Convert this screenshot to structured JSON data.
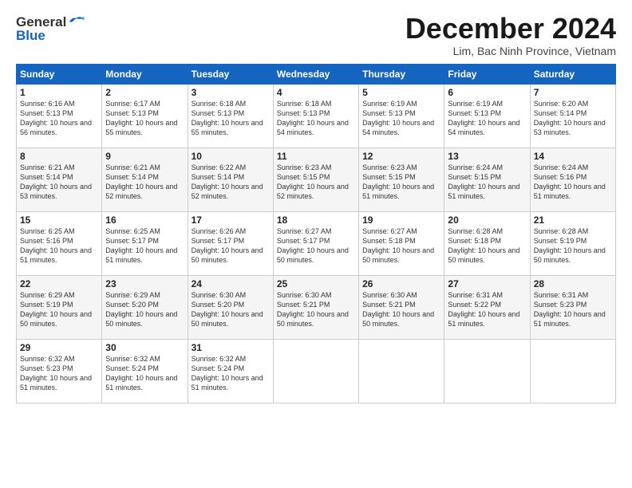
{
  "logo": {
    "general": "General",
    "blue": "Blue"
  },
  "title": "December 2024",
  "location": "Lim, Bac Ninh Province, Vietnam",
  "weekdays": [
    "Sunday",
    "Monday",
    "Tuesday",
    "Wednesday",
    "Thursday",
    "Friday",
    "Saturday"
  ],
  "weeks": [
    [
      {
        "day": "1",
        "sunrise": "6:16 AM",
        "sunset": "5:13 PM",
        "daylight": "10 hours and 56 minutes."
      },
      {
        "day": "2",
        "sunrise": "6:17 AM",
        "sunset": "5:13 PM",
        "daylight": "10 hours and 55 minutes."
      },
      {
        "day": "3",
        "sunrise": "6:18 AM",
        "sunset": "5:13 PM",
        "daylight": "10 hours and 55 minutes."
      },
      {
        "day": "4",
        "sunrise": "6:18 AM",
        "sunset": "5:13 PM",
        "daylight": "10 hours and 54 minutes."
      },
      {
        "day": "5",
        "sunrise": "6:19 AM",
        "sunset": "5:13 PM",
        "daylight": "10 hours and 54 minutes."
      },
      {
        "day": "6",
        "sunrise": "6:19 AM",
        "sunset": "5:13 PM",
        "daylight": "10 hours and 54 minutes."
      },
      {
        "day": "7",
        "sunrise": "6:20 AM",
        "sunset": "5:14 PM",
        "daylight": "10 hours and 53 minutes."
      }
    ],
    [
      {
        "day": "8",
        "sunrise": "6:21 AM",
        "sunset": "5:14 PM",
        "daylight": "10 hours and 53 minutes."
      },
      {
        "day": "9",
        "sunrise": "6:21 AM",
        "sunset": "5:14 PM",
        "daylight": "10 hours and 52 minutes."
      },
      {
        "day": "10",
        "sunrise": "6:22 AM",
        "sunset": "5:14 PM",
        "daylight": "10 hours and 52 minutes."
      },
      {
        "day": "11",
        "sunrise": "6:23 AM",
        "sunset": "5:15 PM",
        "daylight": "10 hours and 52 minutes."
      },
      {
        "day": "12",
        "sunrise": "6:23 AM",
        "sunset": "5:15 PM",
        "daylight": "10 hours and 51 minutes."
      },
      {
        "day": "13",
        "sunrise": "6:24 AM",
        "sunset": "5:15 PM",
        "daylight": "10 hours and 51 minutes."
      },
      {
        "day": "14",
        "sunrise": "6:24 AM",
        "sunset": "5:16 PM",
        "daylight": "10 hours and 51 minutes."
      }
    ],
    [
      {
        "day": "15",
        "sunrise": "6:25 AM",
        "sunset": "5:16 PM",
        "daylight": "10 hours and 51 minutes."
      },
      {
        "day": "16",
        "sunrise": "6:25 AM",
        "sunset": "5:17 PM",
        "daylight": "10 hours and 51 minutes."
      },
      {
        "day": "17",
        "sunrise": "6:26 AM",
        "sunset": "5:17 PM",
        "daylight": "10 hours and 50 minutes."
      },
      {
        "day": "18",
        "sunrise": "6:27 AM",
        "sunset": "5:17 PM",
        "daylight": "10 hours and 50 minutes."
      },
      {
        "day": "19",
        "sunrise": "6:27 AM",
        "sunset": "5:18 PM",
        "daylight": "10 hours and 50 minutes."
      },
      {
        "day": "20",
        "sunrise": "6:28 AM",
        "sunset": "5:18 PM",
        "daylight": "10 hours and 50 minutes."
      },
      {
        "day": "21",
        "sunrise": "6:28 AM",
        "sunset": "5:19 PM",
        "daylight": "10 hours and 50 minutes."
      }
    ],
    [
      {
        "day": "22",
        "sunrise": "6:29 AM",
        "sunset": "5:19 PM",
        "daylight": "10 hours and 50 minutes."
      },
      {
        "day": "23",
        "sunrise": "6:29 AM",
        "sunset": "5:20 PM",
        "daylight": "10 hours and 50 minutes."
      },
      {
        "day": "24",
        "sunrise": "6:30 AM",
        "sunset": "5:20 PM",
        "daylight": "10 hours and 50 minutes."
      },
      {
        "day": "25",
        "sunrise": "6:30 AM",
        "sunset": "5:21 PM",
        "daylight": "10 hours and 50 minutes."
      },
      {
        "day": "26",
        "sunrise": "6:30 AM",
        "sunset": "5:21 PM",
        "daylight": "10 hours and 50 minutes."
      },
      {
        "day": "27",
        "sunrise": "6:31 AM",
        "sunset": "5:22 PM",
        "daylight": "10 hours and 51 minutes."
      },
      {
        "day": "28",
        "sunrise": "6:31 AM",
        "sunset": "5:23 PM",
        "daylight": "10 hours and 51 minutes."
      }
    ],
    [
      {
        "day": "29",
        "sunrise": "6:32 AM",
        "sunset": "5:23 PM",
        "daylight": "10 hours and 51 minutes."
      },
      {
        "day": "30",
        "sunrise": "6:32 AM",
        "sunset": "5:24 PM",
        "daylight": "10 hours and 51 minutes."
      },
      {
        "day": "31",
        "sunrise": "6:32 AM",
        "sunset": "5:24 PM",
        "daylight": "10 hours and 51 minutes."
      },
      null,
      null,
      null,
      null
    ]
  ]
}
